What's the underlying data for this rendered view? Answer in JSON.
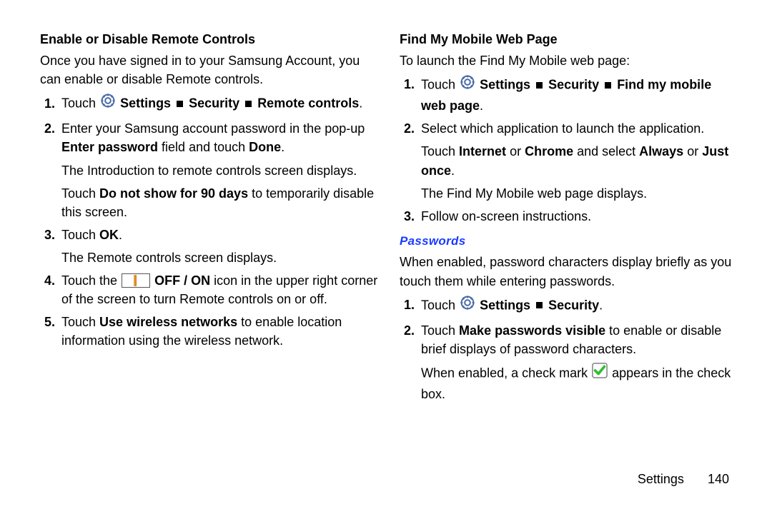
{
  "footer": {
    "section": "Settings",
    "page": "140"
  },
  "left": {
    "title": "Enable or Disable Remote Controls",
    "intro": "Once you have signed in to your Samsung Account, you can enable or disable Remote controls.",
    "li1": {
      "pre": "Touch ",
      "b1": "Settings",
      "b2": "Security",
      "b3": "Remote controls",
      "post": "."
    },
    "li2": {
      "a": "Enter your Samsung account password in the pop-up ",
      "b": "Enter password",
      "c": " field and touch ",
      "d": "Done",
      "e": ".",
      "p2": "The Introduction to remote controls screen displays.",
      "p3a": "Touch ",
      "p3b": "Do not show for 90 days",
      "p3c": " to temporarily disable this screen."
    },
    "li3": {
      "a": "Touch ",
      "b": "OK",
      "c": ".",
      "p2": "The Remote controls screen displays."
    },
    "li4": {
      "a": "Touch the ",
      "b": "OFF / ON",
      "c": " icon in the upper right corner of the screen to turn Remote controls on or off."
    },
    "li5": {
      "a": "Touch ",
      "b": "Use wireless networks",
      "c": " to enable location information using the wireless network."
    }
  },
  "right": {
    "title": "Find My Mobile Web Page",
    "intro": "To launch the Find My Mobile web page:",
    "li1": {
      "pre": "Touch ",
      "b1": "Settings",
      "b2": "Security",
      "b3": "Find my mobile web page",
      "post": "."
    },
    "li2": {
      "a": "Select which application to launch the application.",
      "p2a": "Touch ",
      "p2b": "Internet",
      "p2c": " or ",
      "p2d": "Chrome",
      "p2e": " and select ",
      "p2f": "Always",
      "p2g": " or ",
      "p2h": "Just once",
      "p2i": ".",
      "p3": "The Find My Mobile web page displays."
    },
    "li3": "Follow on-screen instructions.",
    "pw": {
      "heading": "Passwords",
      "intro": "When enabled, password characters display briefly as you touch them while entering passwords.",
      "li1": {
        "pre": "Touch ",
        "b1": "Settings",
        "b2": "Security",
        "post": "."
      },
      "li2": {
        "a": "Touch ",
        "b": "Make passwords visible",
        "c": " to enable or disable brief displays of password characters.",
        "p2a": "When enabled, a check mark ",
        "p2b": " appears in the check box."
      }
    }
  }
}
